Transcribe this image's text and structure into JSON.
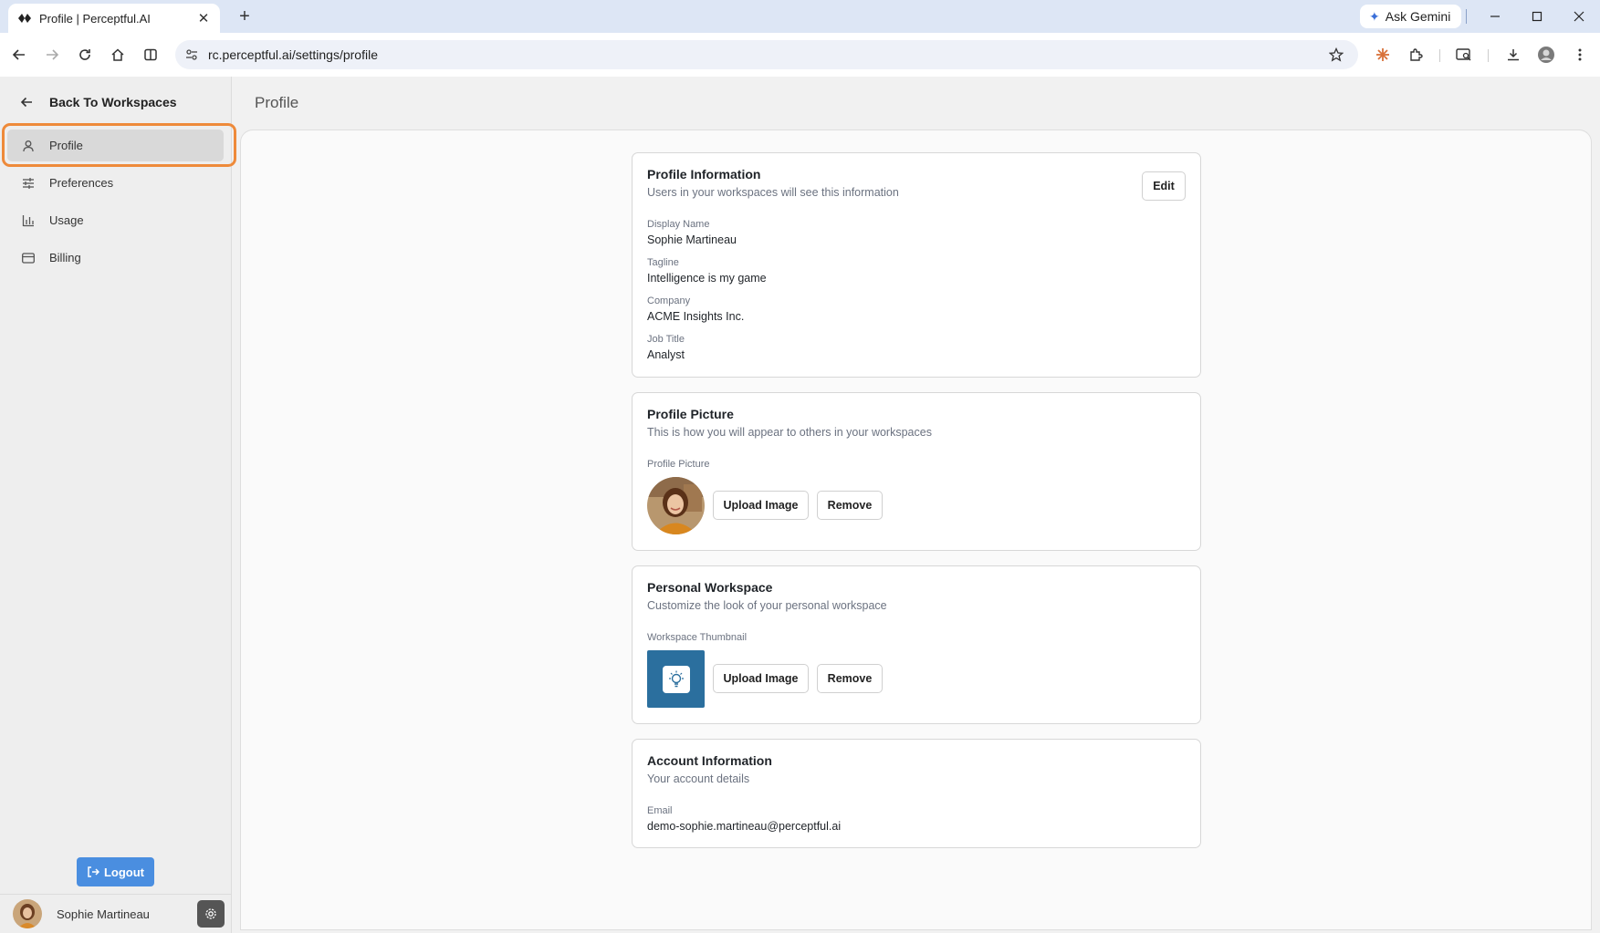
{
  "browser": {
    "tab_title": "Profile | Perceptful.AI",
    "url": "rc.perceptful.ai/settings/profile",
    "ask_gemini": "Ask Gemini"
  },
  "sidebar": {
    "back_label": "Back To Workspaces",
    "items": [
      {
        "label": "Profile",
        "icon": "user-icon",
        "active": true
      },
      {
        "label": "Preferences",
        "icon": "sliders-icon",
        "active": false
      },
      {
        "label": "Usage",
        "icon": "bar-chart-icon",
        "active": false
      },
      {
        "label": "Billing",
        "icon": "credit-card-icon",
        "active": false
      }
    ],
    "logout_label": "Logout",
    "user_name": "Sophie Martineau"
  },
  "page": {
    "title": "Profile"
  },
  "profile_info": {
    "title": "Profile Information",
    "subtitle": "Users in your workspaces will see this information",
    "edit_label": "Edit",
    "fields": [
      {
        "label": "Display Name",
        "value": "Sophie Martineau"
      },
      {
        "label": "Tagline",
        "value": "Intelligence is my game"
      },
      {
        "label": "Company",
        "value": "ACME Insights Inc."
      },
      {
        "label": "Job Title",
        "value": "Analyst"
      }
    ]
  },
  "profile_picture": {
    "title": "Profile Picture",
    "subtitle": "This is how you will appear to others in your workspaces",
    "field_label": "Profile Picture",
    "upload_label": "Upload Image",
    "remove_label": "Remove"
  },
  "personal_workspace": {
    "title": "Personal Workspace",
    "subtitle": "Customize the look of your personal workspace",
    "field_label": "Workspace Thumbnail",
    "upload_label": "Upload Image",
    "remove_label": "Remove",
    "thumbnail_color": "#2b6f9e"
  },
  "account_info": {
    "title": "Account Information",
    "subtitle": "Your account details",
    "email_label": "Email",
    "email_value": "demo-sophie.martineau@perceptful.ai"
  },
  "colors": {
    "accent": "#4a8ee0",
    "highlight": "#ee8a3a"
  }
}
